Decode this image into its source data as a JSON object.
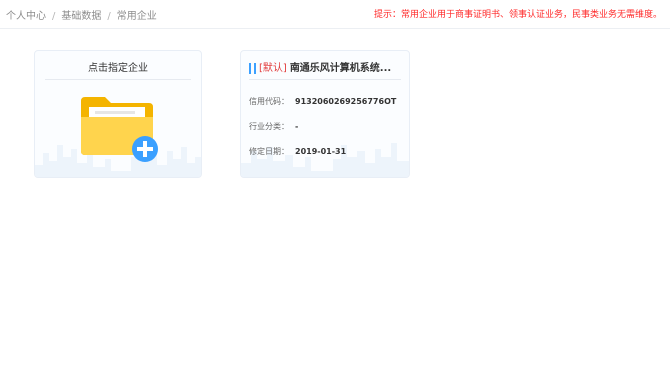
{
  "breadcrumb": {
    "items": [
      "个人中心",
      "基础数据",
      "常用企业"
    ],
    "separator": "/"
  },
  "notice": "提示：常用企业用于商事证明书、领事认证业务，民事类业务无需维度。",
  "add_card": {
    "title": "点击指定企业",
    "icon": "folder-add-icon"
  },
  "company_card": {
    "icon": "building-icon",
    "tag": "[默认]",
    "name": "南通乐风计算机系统...",
    "fields": [
      {
        "label": "信用代码：",
        "value": "9132060269256776OT"
      },
      {
        "label": "行业分类：",
        "value": "-"
      },
      {
        "label": "修定日期：",
        "value": "2019-01-31"
      }
    ]
  },
  "colors": {
    "notice": "#ff2a2a",
    "tag_default": "#e23b3b",
    "folder": "#ffc93c",
    "plus": "#3ba0ff"
  }
}
